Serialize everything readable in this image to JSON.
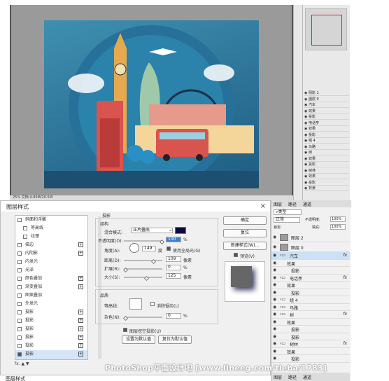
{
  "colors": {
    "accent": "#3c7fd1",
    "shadow_color": "#0a0a3c",
    "ps_dark": "#535353"
  },
  "ps_top": {
    "status": "25% 文档:4.00M/20.5M"
  },
  "ps_layers_small": [
    {
      "label": "阴影 1"
    },
    {
      "label": "图层 0"
    },
    {
      "label": "汽车"
    },
    {
      "label": "效果"
    },
    {
      "label": "投影"
    },
    {
      "label": "电话亭"
    },
    {
      "label": "效果"
    },
    {
      "label": "投影"
    },
    {
      "label": "组 4"
    },
    {
      "label": "马路"
    },
    {
      "label": "树"
    },
    {
      "label": "效果"
    },
    {
      "label": "投影"
    },
    {
      "label": "树林"
    },
    {
      "label": "效果"
    },
    {
      "label": "投影"
    },
    {
      "label": "背景"
    }
  ],
  "dialog": {
    "title": "图层样式",
    "close": "×",
    "fx_items": [
      {
        "label": "斜面和浮雕",
        "checked": false,
        "plus": false,
        "indent": false
      },
      {
        "label": "等高线",
        "checked": false,
        "plus": false,
        "indent": true
      },
      {
        "label": "纹理",
        "checked": false,
        "plus": false,
        "indent": true
      },
      {
        "label": "描边",
        "checked": false,
        "plus": true,
        "indent": false
      },
      {
        "label": "内阴影",
        "checked": false,
        "plus": true,
        "indent": false
      },
      {
        "label": "内发光",
        "checked": false,
        "plus": false,
        "indent": false
      },
      {
        "label": "光泽",
        "checked": false,
        "plus": false,
        "indent": false
      },
      {
        "label": "颜色叠加",
        "checked": false,
        "plus": true,
        "indent": false
      },
      {
        "label": "渐变叠加",
        "checked": false,
        "plus": true,
        "indent": false
      },
      {
        "label": "图案叠加",
        "checked": false,
        "plus": false,
        "indent": false
      },
      {
        "label": "外发光",
        "checked": false,
        "plus": false,
        "indent": false
      },
      {
        "label": "投影",
        "checked": false,
        "plus": true,
        "indent": false
      },
      {
        "label": "投影",
        "checked": false,
        "plus": true,
        "indent": false
      },
      {
        "label": "投影",
        "checked": false,
        "plus": true,
        "indent": false
      },
      {
        "label": "投影",
        "checked": false,
        "plus": true,
        "indent": false
      },
      {
        "label": "投影",
        "checked": false,
        "plus": true,
        "indent": false
      },
      {
        "label": "投影",
        "checked": true,
        "plus": true,
        "indent": false,
        "selected": true
      }
    ],
    "fx_bottom": "fx. ▲ ▼",
    "section_title": "投影",
    "structure_label": "结构",
    "blend_mode_label": "混合模式:",
    "blend_mode_value": "正片叠底",
    "opacity_label": "不透明度(O):",
    "opacity_value": "100",
    "angle_label": "角度(A):",
    "angle_value": "149",
    "angle_unit": "度",
    "global_light_label": "使用全局光(G)",
    "distance_label": "距离(D):",
    "distance_value": "109",
    "distance_unit": "像素",
    "spread_label": "扩展(R):",
    "spread_value": "0",
    "size_label": "大小(S):",
    "size_value": "125",
    "size_unit": "像素",
    "quality_label": "品质",
    "contour_label": "等高线:",
    "antialias_label": "消除锯齿(L)",
    "noise_label": "杂色(N):",
    "noise_value": "0",
    "knockout_label": "图层挖空投影(U)",
    "default_btn": "设置为默认值",
    "reset_btn": "复位为默认值",
    "ok": "确定",
    "reset": "复位",
    "new_style": "新建样式(W)...",
    "preview_label": "预览(V)",
    "percent": "%"
  },
  "dialog2": {
    "title": "图层样式"
  },
  "layers": {
    "tabs": [
      "图层",
      "路径",
      "通道"
    ],
    "kind": "类型",
    "mode": "正常",
    "opacity_label": "不透明度:",
    "opacity": "100%",
    "lock": "锁定:",
    "fill_label": "填充:",
    "fill": "100%",
    "rows": [
      {
        "label": "图层 2",
        "type": "layer"
      },
      {
        "label": "图层 0",
        "type": "layer"
      },
      {
        "label": "汽车",
        "type": "group",
        "fx": "fx",
        "selected": true
      },
      {
        "label": "效果",
        "type": "sub"
      },
      {
        "label": "投影",
        "type": "sub2"
      },
      {
        "label": "电话亭",
        "type": "group",
        "fx": "fx"
      },
      {
        "label": "效果",
        "type": "sub"
      },
      {
        "label": "投影",
        "type": "sub2"
      },
      {
        "label": "组 4",
        "type": "group"
      },
      {
        "label": "马路",
        "type": "group"
      },
      {
        "label": "树",
        "type": "group",
        "fx": "fx"
      },
      {
        "label": "效果",
        "type": "sub"
      },
      {
        "label": "投影",
        "type": "sub2"
      },
      {
        "label": "投影",
        "type": "sub2"
      },
      {
        "label": "树林",
        "type": "group",
        "fx": "fx"
      },
      {
        "label": "效果",
        "type": "sub"
      },
      {
        "label": "投影",
        "type": "sub2"
      }
    ],
    "bottom_tabs": [
      "图层",
      "路径",
      "通道"
    ]
  },
  "watermark": "PhotoShop平面设计吧  [www.lineeg.com/tieba/1783]"
}
